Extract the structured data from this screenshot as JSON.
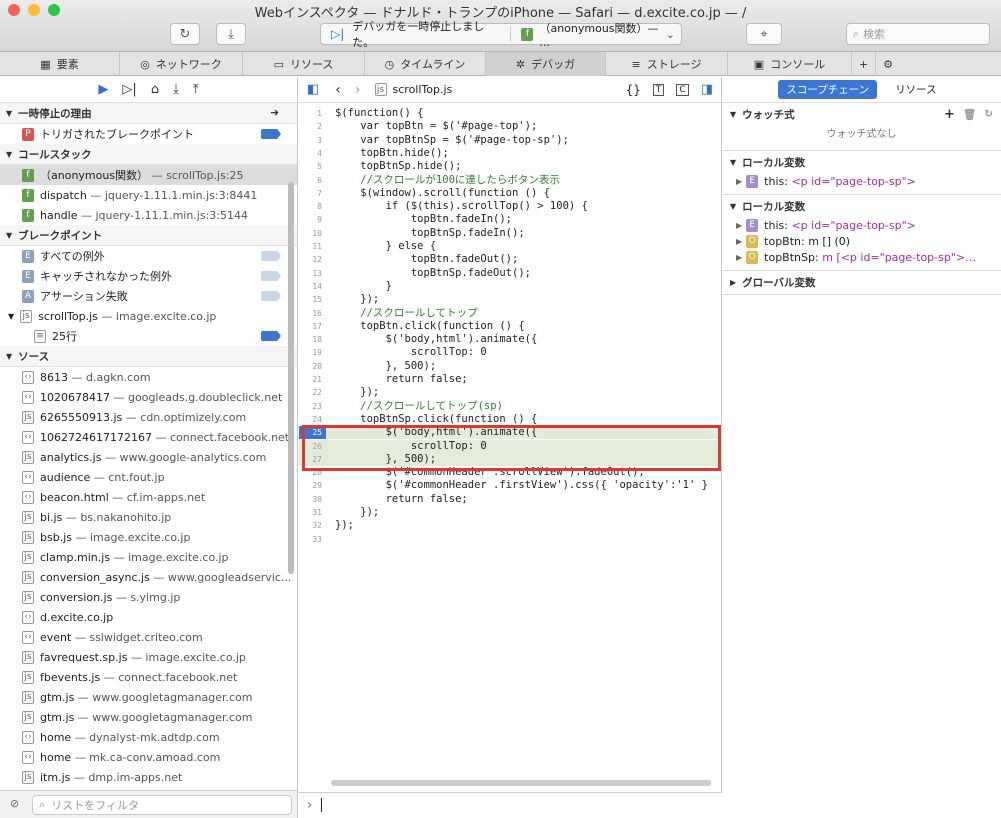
{
  "window": {
    "title": "Webインスペクタ — ドナルド・トランプのiPhone — Safari — d.excite.co.jp — /",
    "status_text": "デバッガを一時停止しました。",
    "status_frame": "（anonymous関数）— ...",
    "search_placeholder": "検索"
  },
  "tabs": [
    {
      "label": "要素"
    },
    {
      "label": "ネットワーク"
    },
    {
      "label": "リソース"
    },
    {
      "label": "タイムライン"
    },
    {
      "label": "デバッガ"
    },
    {
      "label": "ストレージ"
    },
    {
      "label": "コンソール"
    }
  ],
  "sidebar": {
    "pause_reason_header": "一時停止の理由",
    "pause_reason": "トリガされたブレークポイント",
    "callstack_header": "コールスタック",
    "callstack": [
      {
        "name": "（anonymous関数）",
        "loc": "— scrollTop.js:25"
      },
      {
        "name": "dispatch",
        "loc": "— jquery-1.11.1.min.js:3:8441"
      },
      {
        "name": "handle",
        "loc": "— jquery-1.11.1.min.js:3:5144"
      }
    ],
    "breakpoints_header": "ブレークポイント",
    "breakpoints": [
      {
        "label": "すべての例外"
      },
      {
        "label": "キャッチされなかった例外"
      },
      {
        "label": "アサーション失敗"
      }
    ],
    "bp_file": "scrollTop.js",
    "bp_file_host": "— image.excite.co.jp",
    "bp_line": "25行",
    "sources_header": "ソース",
    "sources": [
      {
        "name": "8613",
        "host": "— d.agkn.com"
      },
      {
        "name": "1020678417",
        "host": "— googleads.g.doubleclick.net"
      },
      {
        "name": "6265550913.js",
        "host": "— cdn.optimizely.com"
      },
      {
        "name": "1062724617172167",
        "host": "— connect.facebook.net"
      },
      {
        "name": "analytics.js",
        "host": "— www.google-analytics.com"
      },
      {
        "name": "audience",
        "host": "— cnt.fout.jp"
      },
      {
        "name": "beacon.html",
        "host": "— cf.im-apps.net"
      },
      {
        "name": "bi.js",
        "host": "— bs.nakanohito.jp"
      },
      {
        "name": "bsb.js",
        "host": "— image.excite.co.jp"
      },
      {
        "name": "clamp.min.js",
        "host": "— image.excite.co.jp"
      },
      {
        "name": "conversion_async.js",
        "host": "— www.googleadservic..."
      },
      {
        "name": "conversion.js",
        "host": "— s.yimg.jp"
      },
      {
        "name": "d.excite.co.jp",
        "host": ""
      },
      {
        "name": "event",
        "host": "— sslwidget.criteo.com"
      },
      {
        "name": "favrequest.sp.js",
        "host": "— image.excite.co.jp"
      },
      {
        "name": "fbevents.js",
        "host": "— connect.facebook.net"
      },
      {
        "name": "gtm.js",
        "host": "— www.googletagmanager.com"
      },
      {
        "name": "gtm.js",
        "host": "— www.googletagmanager.com"
      },
      {
        "name": "home",
        "host": "— dynalyst-mk.adtdp.com"
      },
      {
        "name": "home",
        "host": "— mk.ca-conv.amoad.com"
      },
      {
        "name": "itm.js",
        "host": "— dmp.im-apps.net"
      }
    ],
    "filter_placeholder": "リストをフィルタ"
  },
  "editor": {
    "filename": "scrollTop.js",
    "lines": [
      {
        "n": "1",
        "t": "$(function() {"
      },
      {
        "n": "2",
        "t": "    var topBtn = $('#page-top');"
      },
      {
        "n": "3",
        "t": "    var topBtnSp = $('#page-top-sp');"
      },
      {
        "n": "4",
        "t": "    topBtn.hide();"
      },
      {
        "n": "5",
        "t": "    topBtnSp.hide();"
      },
      {
        "n": "6",
        "t": "    //スクロールが100に達したらボタン表示"
      },
      {
        "n": "7",
        "t": "    $(window).scroll(function () {"
      },
      {
        "n": "8",
        "t": "        if ($(this).scrollTop() > 100) {"
      },
      {
        "n": "9",
        "t": "            topBtn.fadeIn();"
      },
      {
        "n": "10",
        "t": "            topBtnSp.fadeIn();"
      },
      {
        "n": "11",
        "t": "        } else {"
      },
      {
        "n": "12",
        "t": "            topBtn.fadeOut();"
      },
      {
        "n": "13",
        "t": "            topBtnSp.fadeOut();"
      },
      {
        "n": "14",
        "t": "        }"
      },
      {
        "n": "15",
        "t": "    });"
      },
      {
        "n": "16",
        "t": "    //スクロールしてトップ"
      },
      {
        "n": "17",
        "t": "    topBtn.click(function () {"
      },
      {
        "n": "18",
        "t": "        $('body,html').animate({"
      },
      {
        "n": "19",
        "t": "            scrollTop: 0"
      },
      {
        "n": "20",
        "t": "        }, 500);"
      },
      {
        "n": "21",
        "t": "        return false;"
      },
      {
        "n": "22",
        "t": "    });"
      },
      {
        "n": "23",
        "t": "    //スクロールしてトップ(sp)"
      },
      {
        "n": "24",
        "t": "    topBtnSp.click(function () {"
      },
      {
        "n": "25",
        "t": "        $('body,html').animate({"
      },
      {
        "n": "26",
        "t": "            scrollTop: 0"
      },
      {
        "n": "27",
        "t": "        }, 500);"
      },
      {
        "n": "28",
        "t": "        $('#commonHeader .scrollView').fadeOut();"
      },
      {
        "n": "29",
        "t": "        $('#commonHeader .firstView').css({ 'opacity':'1' }"
      },
      {
        "n": "30",
        "t": "        return false;"
      },
      {
        "n": "31",
        "t": "    });"
      },
      {
        "n": "32",
        "t": "});"
      },
      {
        "n": "33",
        "t": ""
      }
    ],
    "paused_line": "25"
  },
  "right": {
    "seg_scope": "スコープチェーン",
    "seg_resource": "リソース",
    "watch_header": "ウォッチ式",
    "watch_empty": "ウォッチ式なし",
    "local1_header": "ローカル変数",
    "local1_this": "this:",
    "local1_this_val": "<p id=\"page-top-sp\">",
    "local2_header": "ローカル変数",
    "local2_this": "this:",
    "local2_this_val": "<p id=\"page-top-sp\">",
    "local2_btn": "topBtn:",
    "local2_btn_val": "m [] (0)",
    "local2_btnsp": "topBtnSp:",
    "local2_btnsp_val": "m [<p id=\"page-top-sp\">…",
    "global_header": "グローバル変数"
  },
  "colors": {
    "accent": "#3a76d3",
    "highlight_box": "#e2372f",
    "exec_line": "#e3ebd9"
  }
}
